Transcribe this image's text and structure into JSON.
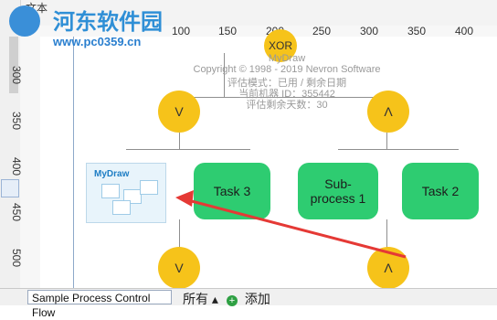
{
  "top_bar": {
    "text": "文本"
  },
  "watermark": {
    "brand": "河东软件园",
    "url": "www.pc0359.cn"
  },
  "ruler": {
    "top": [
      "100",
      "150",
      "200",
      "250",
      "300",
      "350",
      "400"
    ],
    "left": [
      "300",
      "350",
      "400",
      "450",
      "500"
    ]
  },
  "diagram": {
    "xor_label": "XOR",
    "eval_lines": [
      "MyDraw",
      "Copyright © 1998 - 2019 Nevron Software",
      "评估模式：已用 / 剩余日期",
      "当前机器 ID：355442",
      "评估剩余天数：30"
    ],
    "nodes": {
      "v_top": "V",
      "and_top": "Λ",
      "task3": "Task 3",
      "subprocess": "Sub-\nprocess 1",
      "task2": "Task 2",
      "v_bottom": "V",
      "and_bottom": "Λ"
    },
    "preview_label": "MyDraw"
  },
  "tabs": {
    "active": "Sample Process Control Flow",
    "all": "所有",
    "add": "添加"
  }
}
